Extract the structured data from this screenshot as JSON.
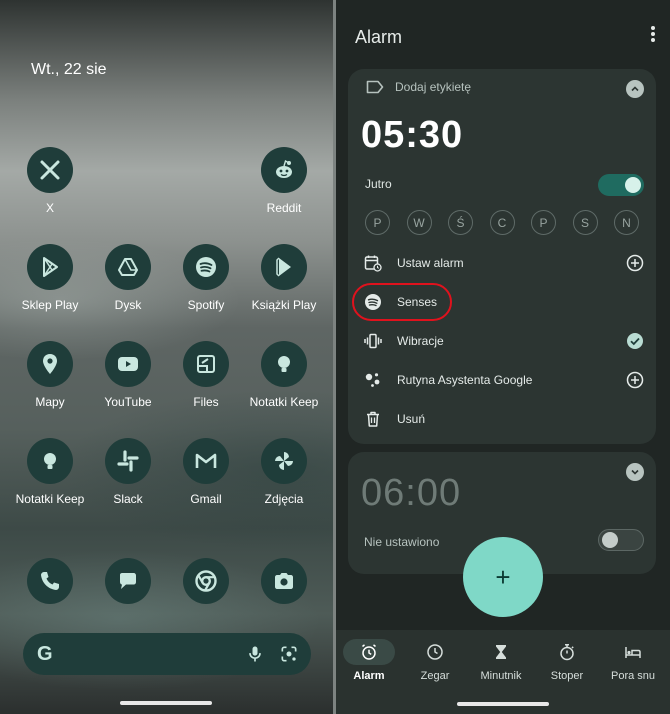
{
  "home": {
    "date": "Wt., 22 sie",
    "apps": [
      {
        "label": "X",
        "icon": "x-icon"
      },
      {
        "label": "Reddit",
        "icon": "reddit-icon"
      },
      {
        "label": "Sklep Play",
        "icon": "play-store-icon"
      },
      {
        "label": "Dysk",
        "icon": "drive-icon"
      },
      {
        "label": "Spotify",
        "icon": "spotify-icon"
      },
      {
        "label": "Książki Play",
        "icon": "play-books-icon"
      },
      {
        "label": "Mapy",
        "icon": "maps-icon"
      },
      {
        "label": "YouTube",
        "icon": "youtube-icon"
      },
      {
        "label": "Files",
        "icon": "files-icon"
      },
      {
        "label": "Notatki Keep",
        "icon": "keep-icon"
      },
      {
        "label": "Notatki Keep",
        "icon": "keep-icon"
      },
      {
        "label": "Slack",
        "icon": "slack-icon"
      },
      {
        "label": "Gmail",
        "icon": "gmail-icon"
      },
      {
        "label": "Zdjęcia",
        "icon": "photos-icon"
      }
    ],
    "dock": [
      "phone-icon",
      "messages-icon",
      "chrome-icon",
      "camera-icon"
    ],
    "search_bar": {
      "logo": "G"
    }
  },
  "clock": {
    "title": "Alarm",
    "alarms": [
      {
        "label_placeholder": "Dodaj etykietę",
        "time": "05:30",
        "schedule": "Jutro",
        "enabled": true,
        "days": [
          "P",
          "W",
          "Ś",
          "C",
          "P",
          "S",
          "N"
        ],
        "options": {
          "set_alarm": "Ustaw alarm",
          "sound": "Senses",
          "vibration": "Wibracje",
          "routine": "Rutyna Asystenta Google",
          "delete": "Usuń"
        }
      },
      {
        "time": "06:00",
        "schedule": "Nie ustawiono",
        "enabled": false
      }
    ],
    "fab": "+",
    "tabs": [
      {
        "label": "Alarm",
        "icon": "alarm-icon",
        "active": true
      },
      {
        "label": "Zegar",
        "icon": "clock-icon",
        "active": false
      },
      {
        "label": "Minutnik",
        "icon": "hourglass-icon",
        "active": false
      },
      {
        "label": "Stoper",
        "icon": "stopwatch-icon",
        "active": false
      },
      {
        "label": "Pora snu",
        "icon": "bed-icon",
        "active": false
      }
    ]
  },
  "colors": {
    "accent": "#7fd8c7",
    "icon_bg": "#1f3d3a",
    "icon_fg": "#c9e7df",
    "card_bg": "#2c3532",
    "highlight": "#e0121d"
  }
}
